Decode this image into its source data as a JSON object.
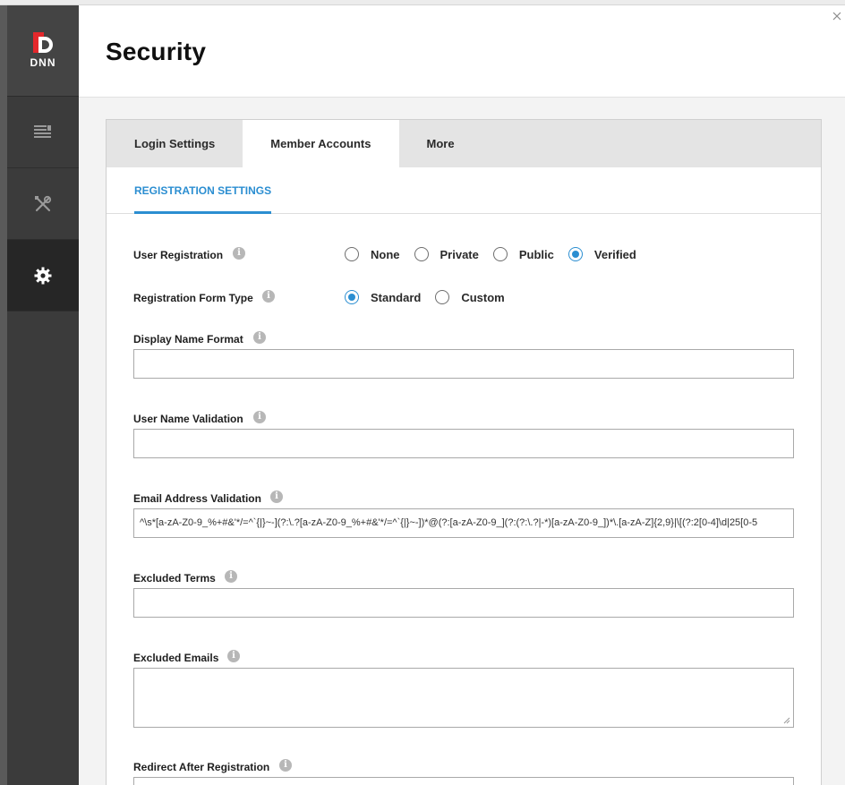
{
  "app": {
    "logo_text": "DNN"
  },
  "sidebar": {
    "items": [
      {
        "icon": "content-list-icon"
      },
      {
        "icon": "tools-icon"
      },
      {
        "icon": "gear-icon",
        "active": true
      }
    ]
  },
  "header": {
    "title": "Security"
  },
  "tabs": [
    {
      "label": "Login Settings",
      "active": false
    },
    {
      "label": "Member Accounts",
      "active": true
    },
    {
      "label": "More",
      "active": false
    }
  ],
  "subtab": {
    "label": "REGISTRATION SETTINGS"
  },
  "form": {
    "user_registration": {
      "label": "User Registration",
      "options": [
        "None",
        "Private",
        "Public",
        "Verified"
      ],
      "selected": "Verified"
    },
    "registration_form_type": {
      "label": "Registration Form Type",
      "options": [
        "Standard",
        "Custom"
      ],
      "selected": "Standard"
    },
    "display_name_format": {
      "label": "Display Name Format",
      "value": ""
    },
    "user_name_validation": {
      "label": "User Name Validation",
      "value": ""
    },
    "email_address_validation": {
      "label": "Email Address Validation",
      "value": "^\\s*[a-zA-Z0-9_%+#&'*/=^`{|}~-](?:\\.?[a-zA-Z0-9_%+#&'*/=^`{|}~-])*@(?:[a-zA-Z0-9_](?:(?:\\.?|-*)[a-zA-Z0-9_])*\\.[a-zA-Z]{2,9}|\\[(?:2[0-4]\\d|25[0-5"
    },
    "excluded_terms": {
      "label": "Excluded Terms",
      "value": ""
    },
    "excluded_emails": {
      "label": "Excluded Emails",
      "value": ""
    },
    "redirect_after_registration": {
      "label": "Redirect After Registration",
      "value": ""
    }
  },
  "colors": {
    "accent": "#2b8ed1",
    "sidebar": "#3b3b3b",
    "logo_red": "#e4282c"
  }
}
